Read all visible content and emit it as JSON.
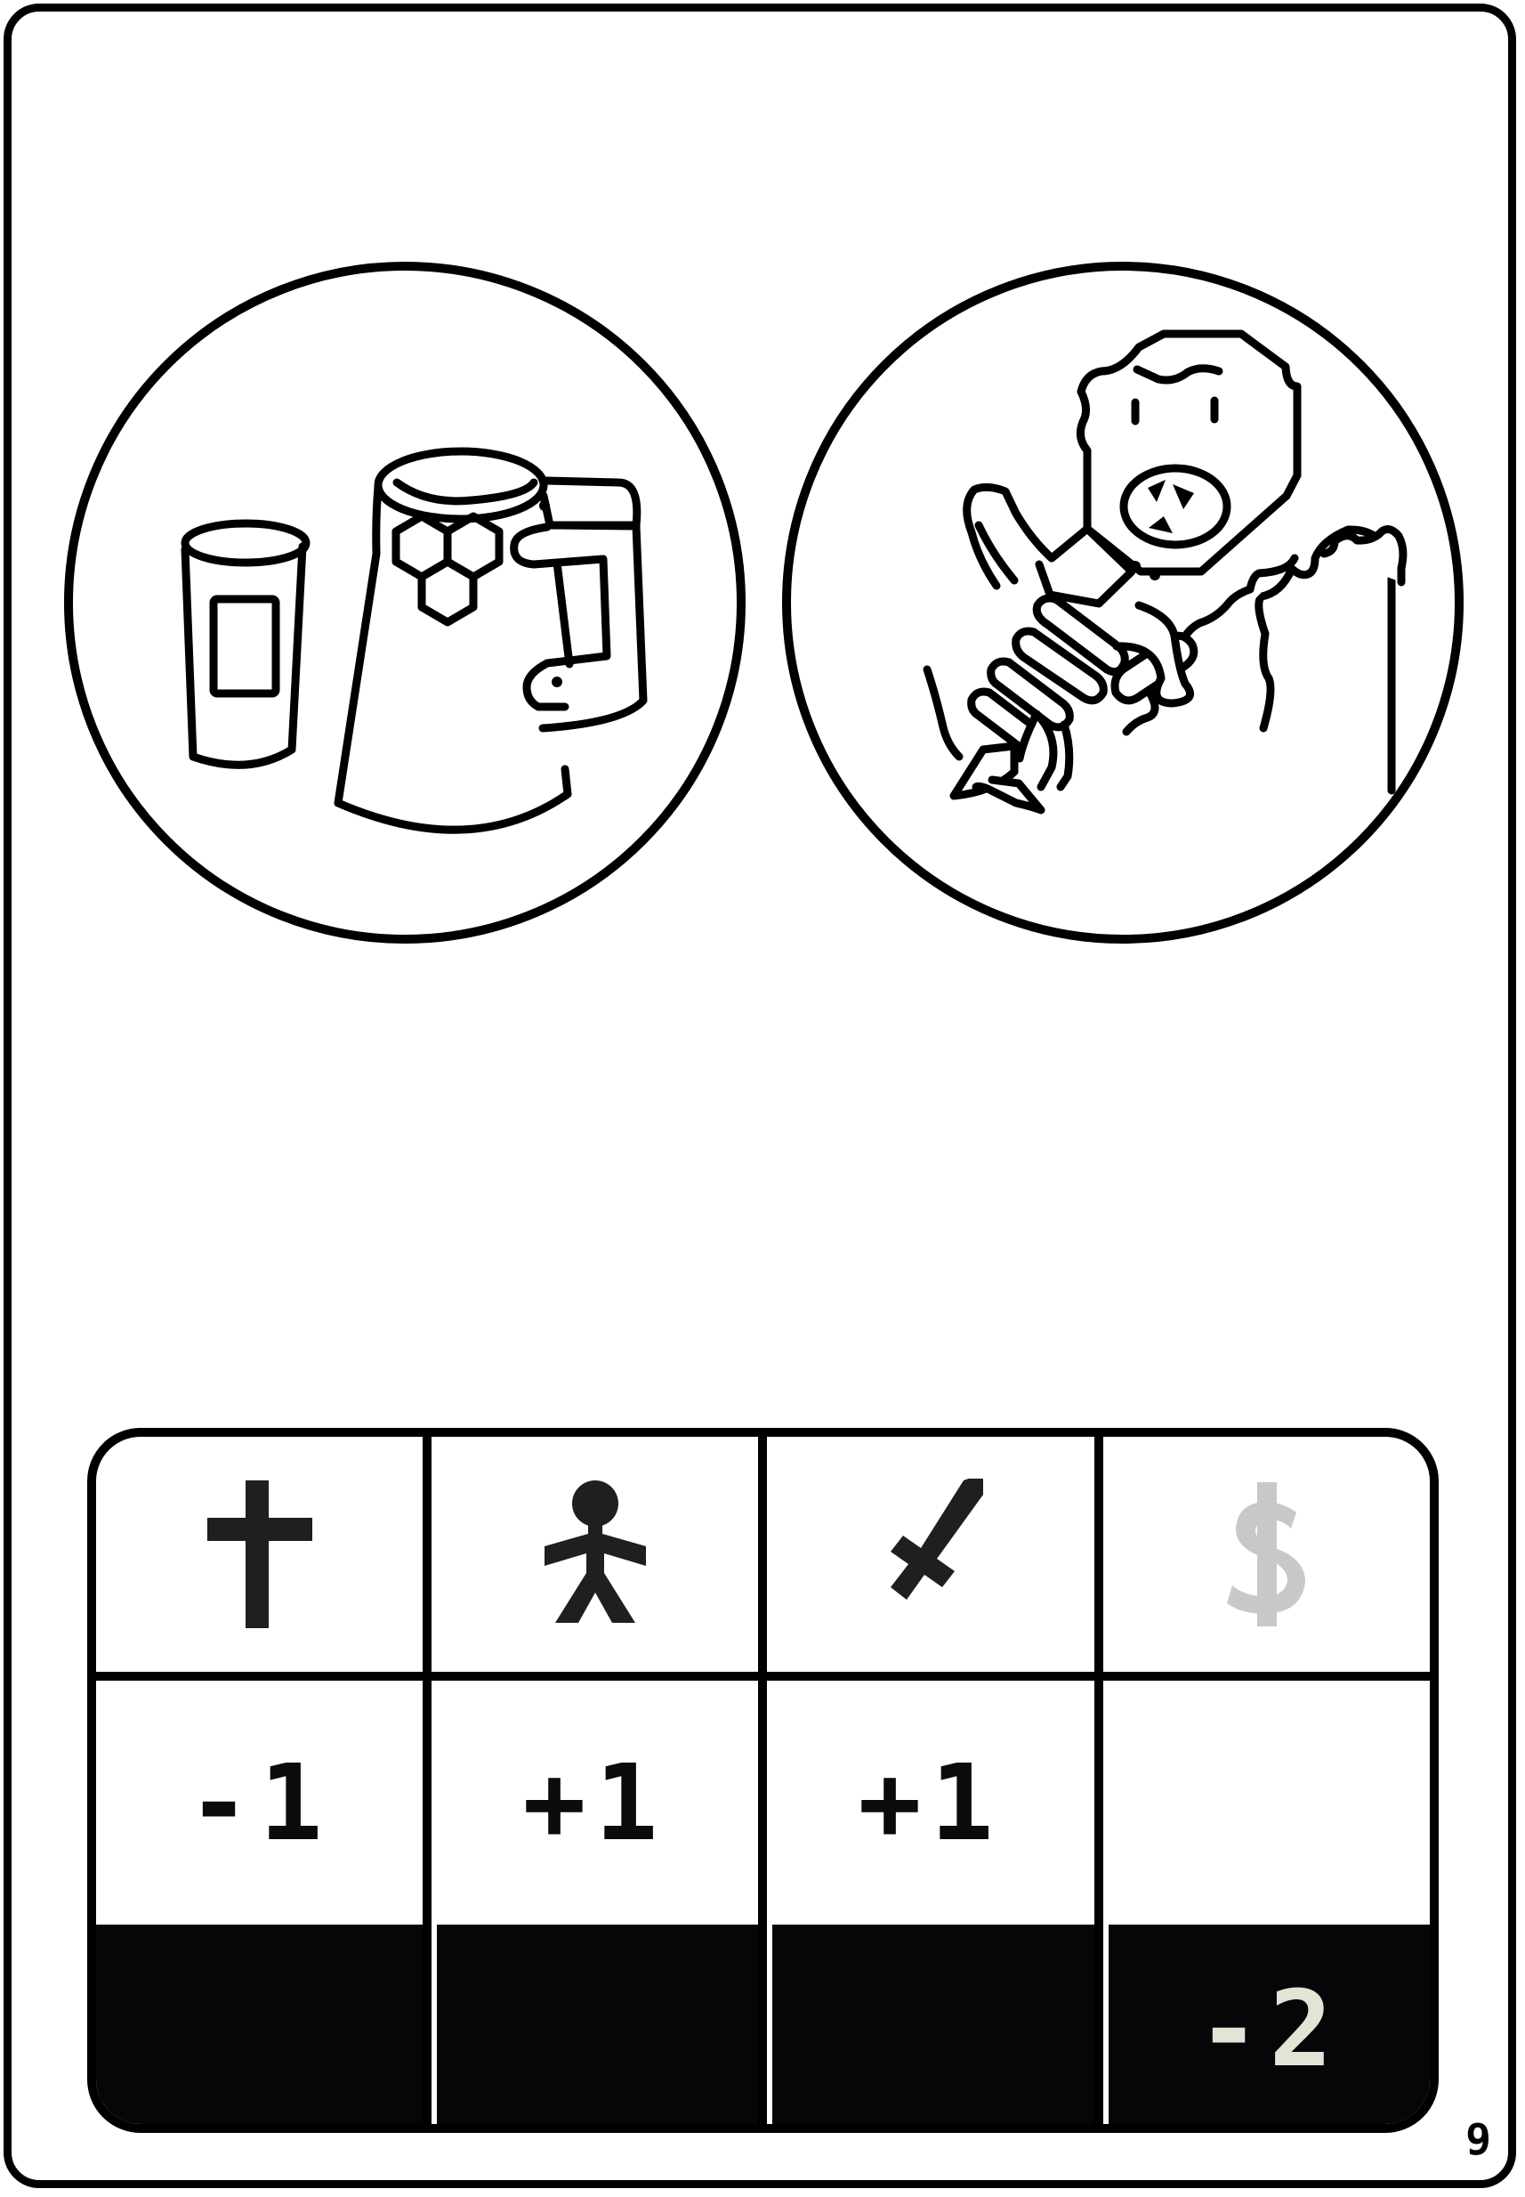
{
  "card": {
    "page_number": "9",
    "illustrations": [
      {
        "name": "containers-illustration",
        "icon": "cans-and-jars"
      },
      {
        "name": "monster-illustration",
        "icon": "ogre-gripping-pipes"
      }
    ]
  },
  "stats_table": {
    "columns": [
      {
        "icon": "cross-icon",
        "color": "#1f1f1f"
      },
      {
        "icon": "person-icon",
        "color": "#1f1f1f"
      },
      {
        "icon": "sword-icon",
        "color": "#1f1f1f"
      },
      {
        "icon": "dollar-icon",
        "color": "#c8c8c8"
      }
    ],
    "row_values": [
      "-1",
      "+1",
      "+1",
      ""
    ],
    "bottom_values": [
      "",
      "",
      "",
      "-2"
    ],
    "colors": {
      "dark_row": "#050607",
      "inverse_text": "#e2e4d6"
    }
  }
}
